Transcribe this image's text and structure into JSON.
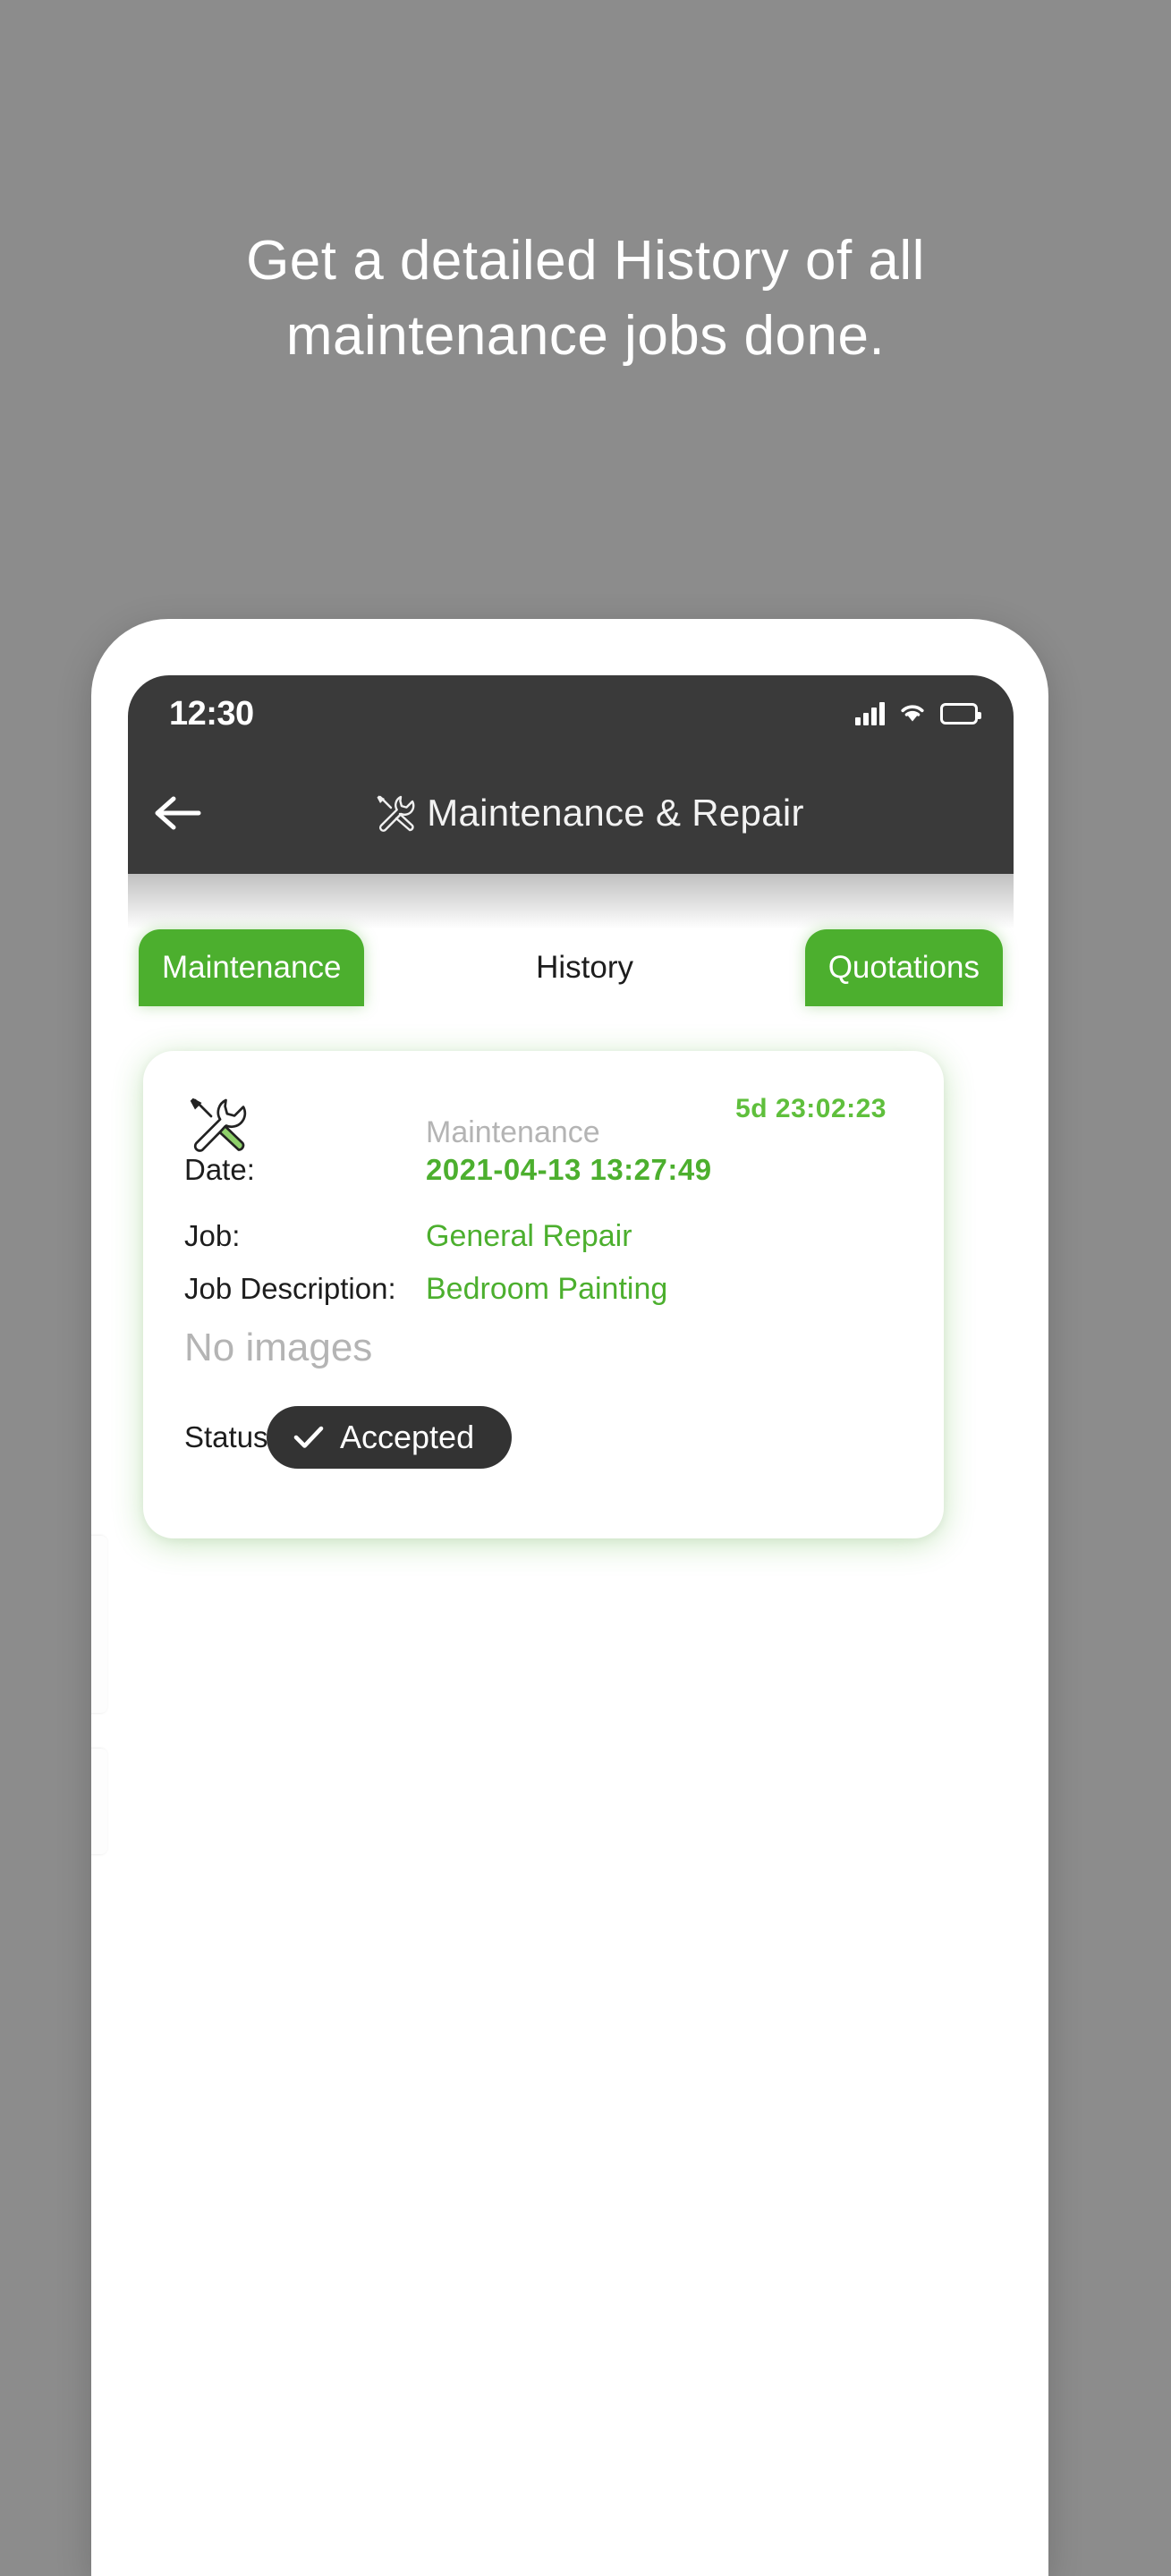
{
  "promo": {
    "line1": "Get a detailed History of all",
    "line2": "maintenance jobs done."
  },
  "phone": {
    "status_bar": {
      "time": "12:30",
      "signal_icon": "signal-bars-icon",
      "wifi_icon": "wifi-icon",
      "battery_icon": "battery-icon"
    },
    "header": {
      "back_icon": "back-arrow-icon",
      "title_icon": "tools-icon",
      "title": "Maintenance & Repair"
    },
    "tabs": [
      {
        "label": "Maintenance",
        "active": false
      },
      {
        "label": "History",
        "active": true
      },
      {
        "label": "Quotations",
        "active": false
      }
    ],
    "card": {
      "type_icon": "tools-icon",
      "kind": "Maintenance",
      "countdown": "5d 23:02:23",
      "fields": [
        {
          "key": "Date:",
          "value": "2021-04-13 13:27:49"
        },
        {
          "key": "Job:",
          "value": "General Repair"
        },
        {
          "key": "Job Description:",
          "value": "Bedroom Painting"
        }
      ],
      "images_placeholder": "No images",
      "status_key": "Status:",
      "status_value": "Accepted",
      "status_check_icon": "check-icon"
    }
  },
  "colors": {
    "background": "#8c8c8c",
    "accent_green": "#4CAF2E",
    "value_green": "#4CAF2E",
    "countdown_green": "#5fbf3c",
    "header_dark": "#3a3a3a",
    "pill_dark": "#333333",
    "muted_gray": "#b4b4b4"
  }
}
